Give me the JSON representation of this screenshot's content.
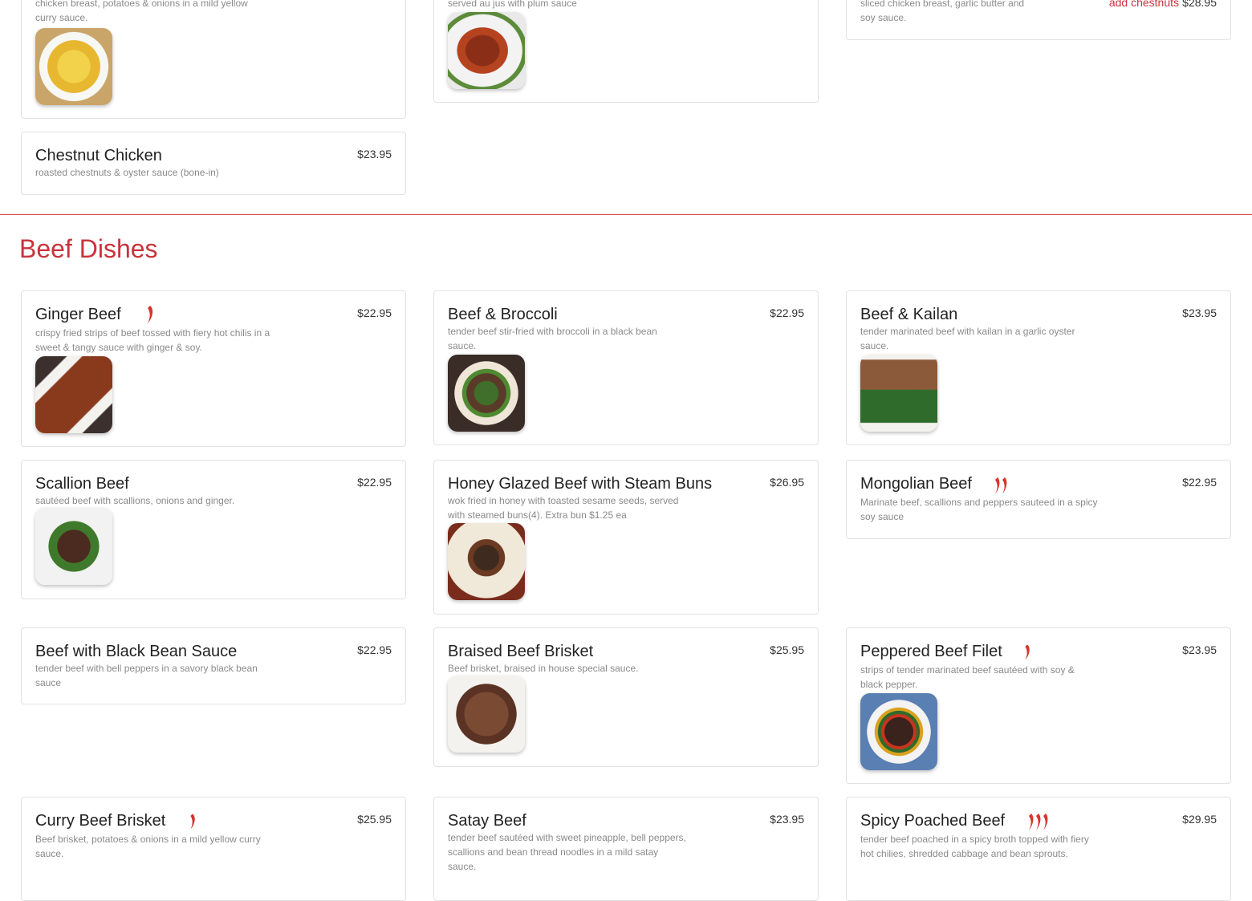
{
  "top": {
    "curry_chicken_desc": "chicken breast, potatoes & onions in a mild yellow curry sauce.",
    "duck_desc": "served au jus with plum sauce",
    "garlic_desc": "sliced chicken breast, garlic butter and soy sauce.",
    "garlic_addon": "add chestnuts",
    "garlic_addon_price": "$28.95",
    "chestnut": {
      "name": "Chestnut Chicken",
      "price": "$23.95",
      "desc": "roasted chestnuts & oyster sauce (bone-in)"
    }
  },
  "section_title": "Beef Dishes",
  "items": [
    {
      "name": "Ginger Beef",
      "price": "$22.95",
      "desc": "crispy fried strips of beef tossed with fiery hot chilis in a sweet & tangy sauce with ginger & soy.",
      "spice": 1
    },
    {
      "name": "Beef & Broccoli",
      "price": "$22.95",
      "desc": "tender beef stir-fried with broccoli in a black bean sauce.",
      "spice": 0
    },
    {
      "name": "Beef & Kailan",
      "price": "$23.95",
      "desc": "tender marinated beef with kailan in a garlic oyster sauce.",
      "spice": 0
    },
    {
      "name": "Scallion Beef",
      "price": "$22.95",
      "desc": "sautéed beef with scallions, onions and ginger.",
      "spice": 0
    },
    {
      "name": "Honey Glazed Beef with Steam Buns",
      "price": "$26.95",
      "desc": "wok fried in honey with toasted sesame seeds, served with steamed buns(4). Extra bun $1.25 ea",
      "spice": 0
    },
    {
      "name": "Mongolian Beef",
      "price": "$22.95",
      "desc": "Marinate beef, scallions and peppers sauteed in a spicy soy sauce",
      "spice": 2
    },
    {
      "name": "Beef with Black Bean Sauce",
      "price": "$22.95",
      "desc": "tender beef with bell peppers in a savory black bean sauce",
      "spice": 0
    },
    {
      "name": "Braised Beef Brisket",
      "price": "$25.95",
      "desc": "Beef brisket, braised in house special sauce.",
      "spice": 0
    },
    {
      "name": "Peppered Beef Filet",
      "price": "$23.95",
      "desc": "strips of tender marinated beef sautéed with soy & black pepper.",
      "spice": 1
    },
    {
      "name": "Curry Beef Brisket",
      "price": "$25.95",
      "desc": "Beef brisket, potatoes & onions in a mild yellow curry sauce.",
      "spice": 1
    },
    {
      "name": "Satay Beef",
      "price": "$23.95",
      "desc": "tender beef sautéed with sweet pineapple, bell peppers, scallions and bean thread noodles in a mild satay sauce.",
      "spice": 0
    },
    {
      "name": "Spicy Poached Beef",
      "price": "$29.95",
      "desc": "tender beef poached in a spicy broth topped with fiery hot chilies, shredded cabbage and bean sprouts.",
      "spice": 3
    }
  ],
  "colors": {
    "accent": "#c9333c",
    "chili": "#d6342b"
  }
}
